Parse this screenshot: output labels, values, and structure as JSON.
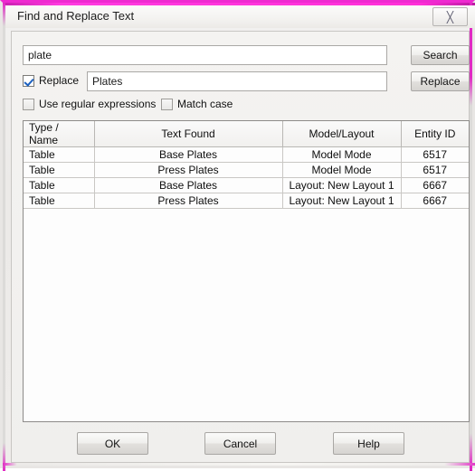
{
  "window": {
    "title": "Find and Replace Text",
    "close_icon": "close-x-icon",
    "accent_color": "#ef2ad0",
    "background_color": "#f0efed"
  },
  "search": {
    "find_value": "plate",
    "find_placeholder": "",
    "search_label": "Search",
    "replace_value": "Plates",
    "replace_placeholder": "",
    "replace_label": "Replace"
  },
  "options": {
    "replace_label": "Replace",
    "replace_checked": true,
    "regex_label": "Use regular expressions",
    "regex_checked": false,
    "match_case_label": "Match case",
    "match_case_checked": false
  },
  "results": {
    "columns": [
      "Type / Name",
      "Text Found",
      "Model/Layout",
      "Entity ID"
    ],
    "rows": [
      [
        "Table",
        "Base Plates",
        "Model Mode",
        "6517"
      ],
      [
        "Table",
        "Press Plates",
        "Model Mode",
        "6517"
      ],
      [
        "Table",
        "Base Plates",
        "Layout: New Layout 1",
        "6667"
      ],
      [
        "Table",
        "Press Plates",
        "Layout: New Layout 1",
        "6667"
      ]
    ]
  },
  "footer": {
    "ok_label": "OK",
    "cancel_label": "Cancel",
    "help_label": "Help"
  }
}
